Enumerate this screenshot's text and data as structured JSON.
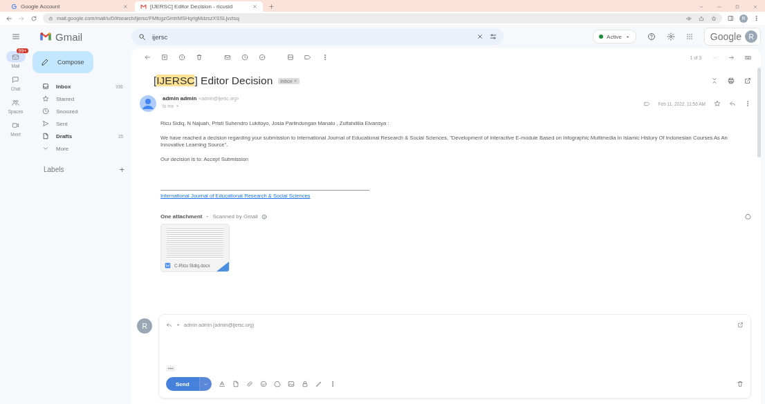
{
  "browser": {
    "tabs": [
      {
        "title": "Google Account",
        "selected": false
      },
      {
        "title": "[IJERSC] Editor Decision - ricusid",
        "selected": true
      }
    ],
    "avatar_letter": "R",
    "url": "mail.google.com/mail/u/0/#search/ijersc/FMfcgzGmtrMSHqrlgMdzszXSSLjvztsq"
  },
  "header": {
    "app_name": "Gmail",
    "search": {
      "value": "ijersc"
    },
    "status": "Active",
    "account_label": "Google",
    "avatar_letter": "R"
  },
  "rail": [
    {
      "label": "Mail",
      "badge": "99+",
      "selected": true
    },
    {
      "label": "Chat",
      "selected": false
    },
    {
      "label": "Spaces",
      "selected": false
    },
    {
      "label": "Meet",
      "selected": false
    }
  ],
  "sidebar": {
    "compose": "Compose",
    "folders": [
      {
        "label": "Inbox",
        "count": "936",
        "unread": true
      },
      {
        "label": "Starred",
        "unread": false
      },
      {
        "label": "Snoozed",
        "unread": false
      },
      {
        "label": "Sent",
        "unread": false
      },
      {
        "label": "Drafts",
        "count": "35",
        "unread": true
      },
      {
        "label": "More",
        "unread": false
      }
    ],
    "labels_heading": "Labels",
    "labels_add": "+"
  },
  "toolbar": {
    "pagination": "1 of 3"
  },
  "message": {
    "subject": [
      {
        "text": "[",
        "highlighted": false
      },
      {
        "text": "IJERSC",
        "highlighted": true
      },
      {
        "text": "] Editor Decision",
        "highlighted": false
      }
    ],
    "label_chip": "Inbox",
    "sender_name": "admin admin",
    "sender_email": "<admin@ijersc.org>",
    "recipient": "to me",
    "date": "Feb 11, 2022, 11:56 AM",
    "body": [
      "Ricu Sidiq, N Najuah, Pristi Suhendro Lukitoyo, Josia Parlindungan Manalu , Zulfahdilla Elvansya :",
      "We have reached a decision regarding your submission to International Journal of Educational Research & Social Sciences, \"Development of Interactive E-module Based on Infographic Multimedia In Islamic History Of Indonesian Courses As An Innovative Learning Source\".",
      "Our decision is to: Accept Submission"
    ],
    "signature_link": "International Journal of Educational Research & Social Sciences"
  },
  "attachments": {
    "heading": "One attachment",
    "scanned": "Scanned by Gmail",
    "files": [
      {
        "name": "C-Ricu Sidiq.docx"
      }
    ]
  },
  "reply": {
    "avatar_letter": "R",
    "recipient": "admin admin (admin@ijersc.org)",
    "send": "Send"
  }
}
